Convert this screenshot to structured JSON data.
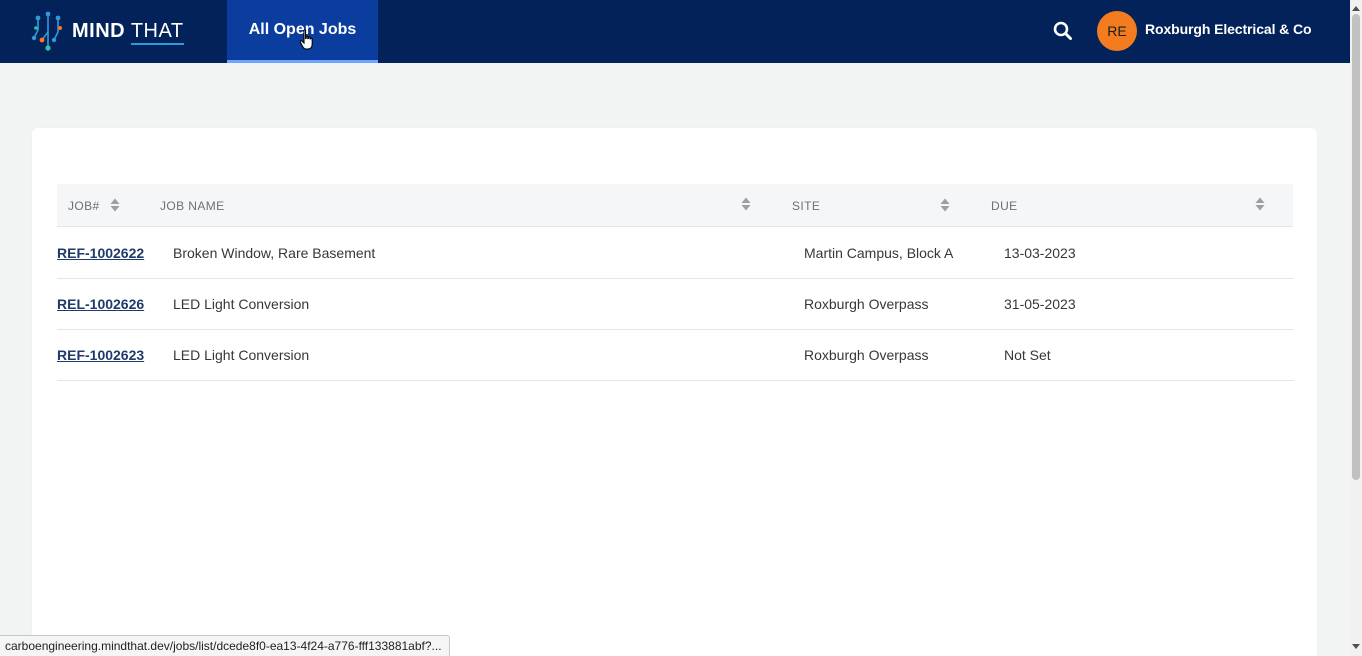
{
  "header": {
    "logo_text_bold": "MIND",
    "logo_text_light": "THAT",
    "nav_tab_label": "All Open Jobs",
    "avatar_initials": "RE",
    "company_name": "Roxburgh Electrical & Co"
  },
  "table": {
    "columns": [
      "JOB#",
      "JOB NAME",
      "SITE",
      "DUE"
    ],
    "rows": [
      {
        "job": "REF-1002622",
        "name": "Broken Window, Rare Basement",
        "site": "Martin Campus, Block A",
        "due": "13-03-2023"
      },
      {
        "job": "REL-1002626",
        "name": "LED Light Conversion",
        "site": "Roxburgh Overpass",
        "due": "31-05-2023"
      },
      {
        "job": "REF-1002623",
        "name": "LED Light Conversion",
        "site": "Roxburgh Overpass",
        "due": "Not Set"
      }
    ]
  },
  "status_bar": {
    "url": "carboengineering.mindthat.dev/jobs/list/dcede8f0-ea13-4f24-a776-fff133881abf?..."
  },
  "colors": {
    "topbar": "#03225a",
    "nav_active": "#0a3d9e",
    "avatar": "#f47c20",
    "link": "#1f3a6b"
  },
  "icons": {
    "search": "search-icon",
    "sort": "sort-icon",
    "cursor": "hand-pointer-icon"
  }
}
